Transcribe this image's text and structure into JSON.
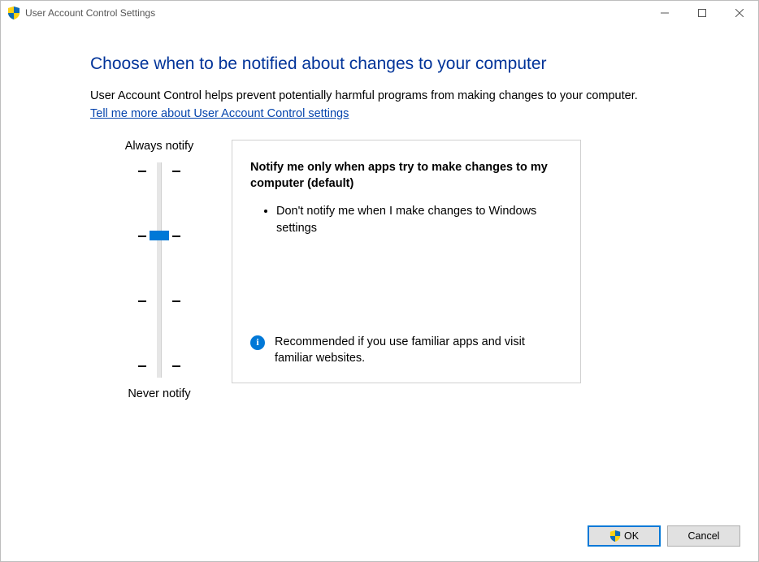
{
  "window": {
    "title": "User Account Control Settings"
  },
  "page": {
    "heading": "Choose when to be notified about changes to your computer",
    "description": "User Account Control helps prevent potentially harmful programs from making changes to your computer.",
    "help_link": "Tell me more about User Account Control settings"
  },
  "slider": {
    "top_label": "Always notify",
    "bottom_label": "Never notify",
    "levels": 4,
    "current_level": 2
  },
  "notification": {
    "title": "Notify me only when apps try to make changes to my computer (default)",
    "bullet": "Don't notify me when I make changes to Windows settings",
    "recommendation": "Recommended if you use familiar apps and visit familiar websites."
  },
  "buttons": {
    "ok": "OK",
    "cancel": "Cancel"
  }
}
